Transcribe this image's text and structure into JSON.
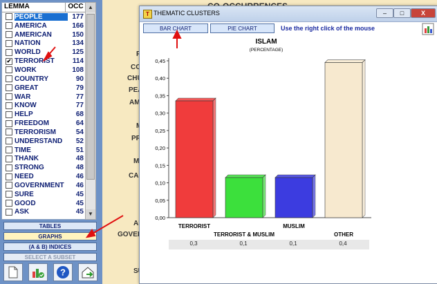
{
  "lemma_panel": {
    "header": {
      "lemma": "LEMMA",
      "occ": "OCC"
    },
    "rows": [
      {
        "label": "PEOPLE",
        "occ": "177",
        "checked": false,
        "selected": true
      },
      {
        "label": "AMERICA",
        "occ": "166",
        "checked": false,
        "selected": false
      },
      {
        "label": "AMERICAN",
        "occ": "150",
        "checked": false,
        "selected": false
      },
      {
        "label": "NATION",
        "occ": "134",
        "checked": false,
        "selected": false
      },
      {
        "label": "WORLD",
        "occ": "125",
        "checked": false,
        "selected": false
      },
      {
        "label": "TERRORIST",
        "occ": "114",
        "checked": true,
        "selected": false
      },
      {
        "label": "WORK",
        "occ": "108",
        "checked": false,
        "selected": false
      },
      {
        "label": "COUNTRY",
        "occ": "90",
        "checked": false,
        "selected": false
      },
      {
        "label": "GREAT",
        "occ": "79",
        "checked": false,
        "selected": false
      },
      {
        "label": "WAR",
        "occ": "77",
        "checked": false,
        "selected": false
      },
      {
        "label": "KNOW",
        "occ": "77",
        "checked": false,
        "selected": false
      },
      {
        "label": "HELP",
        "occ": "68",
        "checked": false,
        "selected": false
      },
      {
        "label": "FREEDOM",
        "occ": "64",
        "checked": false,
        "selected": false
      },
      {
        "label": "TERRORISM",
        "occ": "54",
        "checked": false,
        "selected": false
      },
      {
        "label": "UNDERSTAND",
        "occ": "52",
        "checked": false,
        "selected": false
      },
      {
        "label": "TIME",
        "occ": "51",
        "checked": false,
        "selected": false
      },
      {
        "label": "THANK",
        "occ": "48",
        "checked": false,
        "selected": false
      },
      {
        "label": "STRONG",
        "occ": "48",
        "checked": false,
        "selected": false
      },
      {
        "label": "NEED",
        "occ": "46",
        "checked": false,
        "selected": false
      },
      {
        "label": "GOVERNMENT",
        "occ": "46",
        "checked": false,
        "selected": false
      },
      {
        "label": "SURE",
        "occ": "45",
        "checked": false,
        "selected": false
      },
      {
        "label": "GOOD",
        "occ": "45",
        "checked": false,
        "selected": false
      },
      {
        "label": "ASK",
        "occ": "45",
        "checked": false,
        "selected": false
      }
    ]
  },
  "left_buttons": {
    "tables": "TABLES",
    "graphs": "GRAPHS",
    "ab_indices": "(A & B)  INDICES",
    "select_subset": "SELECT A SUBSET"
  },
  "icon_bar": [
    "document-icon",
    "bar-chart-check-icon",
    "help-icon",
    "home-export-icon"
  ],
  "background_window": {
    "title": "CO-OCCURRENCES",
    "words": [
      "F",
      "CO",
      "CHU",
      "PEA",
      "AM",
      "M",
      "PR",
      "M",
      "CAN",
      "AI",
      "GOVER",
      "SU"
    ]
  },
  "chart_window": {
    "title": "THEMATIC CLUSTERS",
    "controls": {
      "minimize": "–",
      "maximize": "□",
      "close": "X"
    },
    "bar_chart_button": "BAR CHART",
    "pie_chart_button": "PIE CHART",
    "hint": "Use the right click of the mouse",
    "values_row": [
      "0,3",
      "0,1",
      "0,1",
      "0,4"
    ]
  },
  "chart_data": {
    "type": "bar",
    "title": "ISLAM",
    "subtitle": "(PERCENTAGE)",
    "categories": [
      "TERRORIST",
      "TERRORIST & MUSLIM",
      "MUSLIM",
      "OTHER"
    ],
    "values": [
      0.335,
      0.115,
      0.115,
      0.445
    ],
    "colors": [
      "#f03c3c",
      "#3ce03c",
      "#3c3ce0",
      "#f7e9cf"
    ],
    "ylim": [
      0,
      0.45
    ],
    "yticks": [
      "0,00",
      "0,05",
      "0,10",
      "0,15",
      "0,20",
      "0,25",
      "0,30",
      "0,35",
      "0,40",
      "0,45"
    ],
    "xlabel": "",
    "ylabel": "",
    "grid": false
  },
  "annotation_color": "#e01010"
}
